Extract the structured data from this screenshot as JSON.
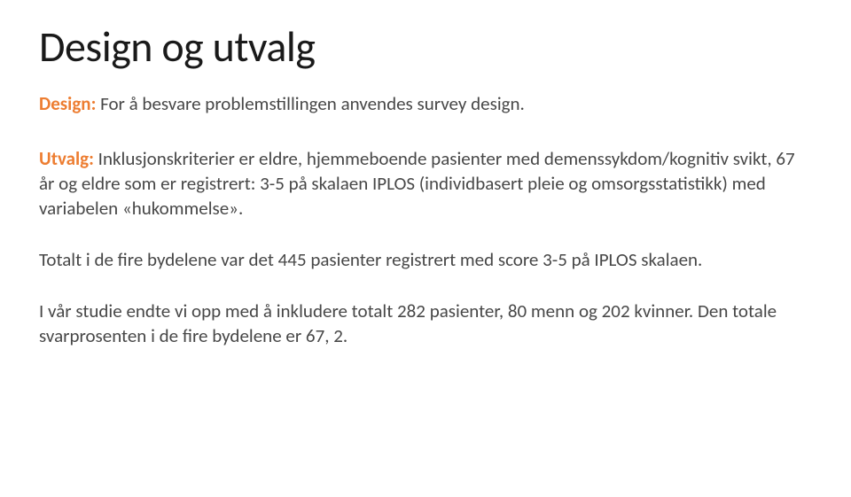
{
  "slide": {
    "title": "Design og utvalg",
    "design": {
      "label": "Design:",
      "text": " For å besvare problemstillingen anvendes survey design."
    },
    "utvalg": {
      "label": "Utvalg:",
      "text": " Inklusjonskriterier er eldre, hjemmeboende pasienter med demenssykdom/kognitiv svikt, 67 år og eldre som er registrert: 3-5 på skalaen IPLOS (individbasert pleie og omsorgsstatistikk) med variabelen «hukommelse»."
    },
    "p3": "Totalt i de fire bydelene var det 445 pasienter registrert med score 3-5 på IPLOS skalaen.",
    "p4": "I vår studie endte vi opp med å inkludere totalt 282 pasienter, 80 menn og 202 kvinner. Den totale svarprosenten i de fire bydelene er 67, 2."
  }
}
